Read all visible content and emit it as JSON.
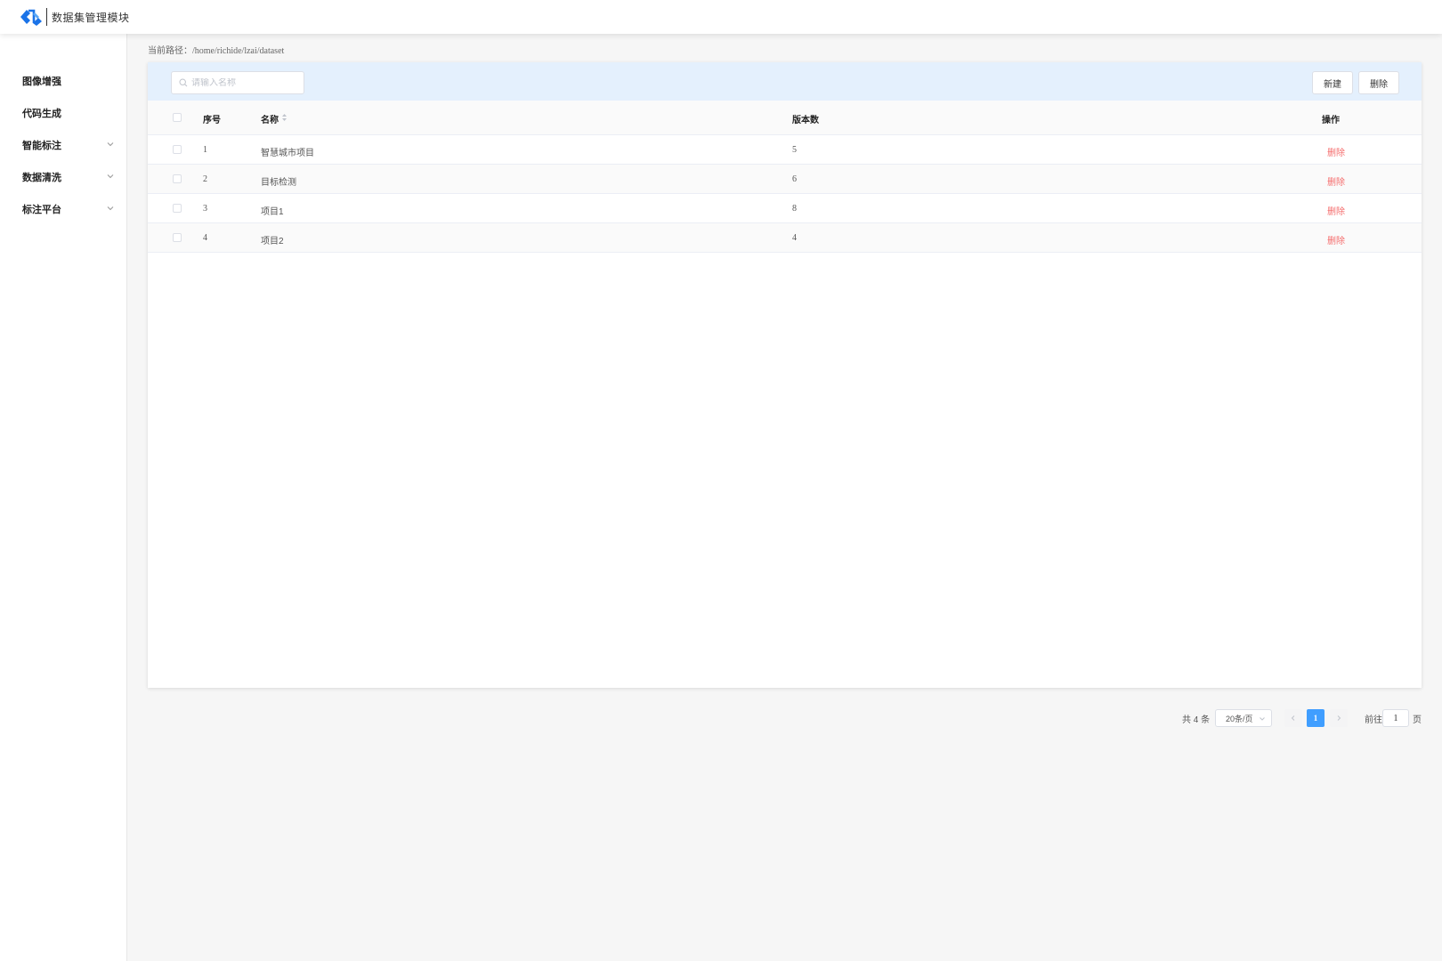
{
  "app": {
    "title": "数据集管理模块",
    "logo": "logo-icon",
    "accent_color": "#409eff"
  },
  "sidebar": {
    "items": [
      {
        "label": "图像增强",
        "has_submenu": false
      },
      {
        "label": "代码生成",
        "has_submenu": false
      },
      {
        "label": "智能标注",
        "has_submenu": true
      },
      {
        "label": "数据清洗",
        "has_submenu": true
      },
      {
        "label": "标注平台",
        "has_submenu": true
      }
    ]
  },
  "breadcrumb": {
    "label": "当前路径：",
    "path": "/home/richide/lzai/dataset"
  },
  "toolbar": {
    "search_placeholder": "请输入名称",
    "new_label": "新建",
    "delete_label": "删除"
  },
  "table": {
    "columns": {
      "index": "序号",
      "name": "名称",
      "versions": "版本数",
      "action": "操作"
    },
    "rows": [
      {
        "index": "1",
        "name": "智慧城市项目",
        "versions": "5",
        "action": "删除"
      },
      {
        "index": "2",
        "name": "目标检测",
        "versions": "6",
        "action": "删除"
      },
      {
        "index": "3",
        "name": "项目1",
        "versions": "8",
        "action": "删除"
      },
      {
        "index": "4",
        "name": "项目2",
        "versions": "4",
        "action": "删除"
      }
    ]
  },
  "pagination": {
    "total": "共 4 条",
    "page_size": "20条/页",
    "current_page": "1",
    "goto_label": "前往",
    "goto_value": "1",
    "page_suffix": "页"
  },
  "colors": {
    "danger": "#f56c6c",
    "toolbar_bg": "#e4f0fd"
  }
}
